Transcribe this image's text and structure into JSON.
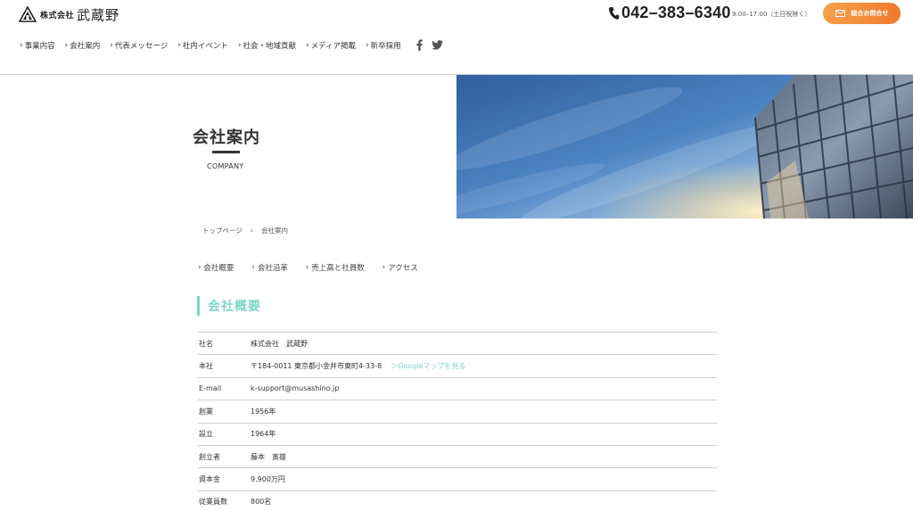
{
  "header": {
    "logo_prefix": "株式会社",
    "logo_name": "武蔵野",
    "phone": "042–383–6340",
    "hours": "9:00–17:00（土日祝除く）",
    "contact_label": "総合お問合せ"
  },
  "nav": {
    "items": [
      {
        "label": "事業内容"
      },
      {
        "label": "会社案内"
      },
      {
        "label": "代表メッセージ"
      },
      {
        "label": "社内イベント"
      },
      {
        "label": "社会・地域貢献"
      },
      {
        "label": "メディア掲載"
      },
      {
        "label": "新卒採用"
      }
    ],
    "social_icons": [
      "facebook-icon",
      "twitter-icon"
    ]
  },
  "hero": {
    "title": "会社案内",
    "subtitle": "COMPANY"
  },
  "breadcrumb": {
    "home": "トップページ",
    "separator": "›",
    "current": "会社案内"
  },
  "subnav": {
    "items": [
      {
        "label": "会社概要"
      },
      {
        "label": "会社沿革"
      },
      {
        "label": "売上高と社員数"
      },
      {
        "label": "アクセス"
      }
    ]
  },
  "section": {
    "title": "会社概要"
  },
  "company_table": {
    "rows": [
      {
        "key": "社名",
        "value": "株式会社　武蔵野"
      },
      {
        "key": "本社",
        "value": "〒184-0011 東京都小金井市東町4-33-8",
        "link": "＞Googleマップを見る"
      },
      {
        "key": "E-mail",
        "value": "k-support@musashino.jp"
      },
      {
        "key": "創業",
        "value": "1956年"
      },
      {
        "key": "設立",
        "value": "1964年"
      },
      {
        "key": "創立者",
        "value": "藤本　寅雄"
      },
      {
        "key": "資本金",
        "value": "9,900万円"
      },
      {
        "key": "従業員数",
        "value": "800名"
      }
    ]
  },
  "colors": {
    "accent": "#7dd6c7",
    "contact_button": "#f28a38",
    "text": "#333333",
    "divider": "#cccccc"
  }
}
